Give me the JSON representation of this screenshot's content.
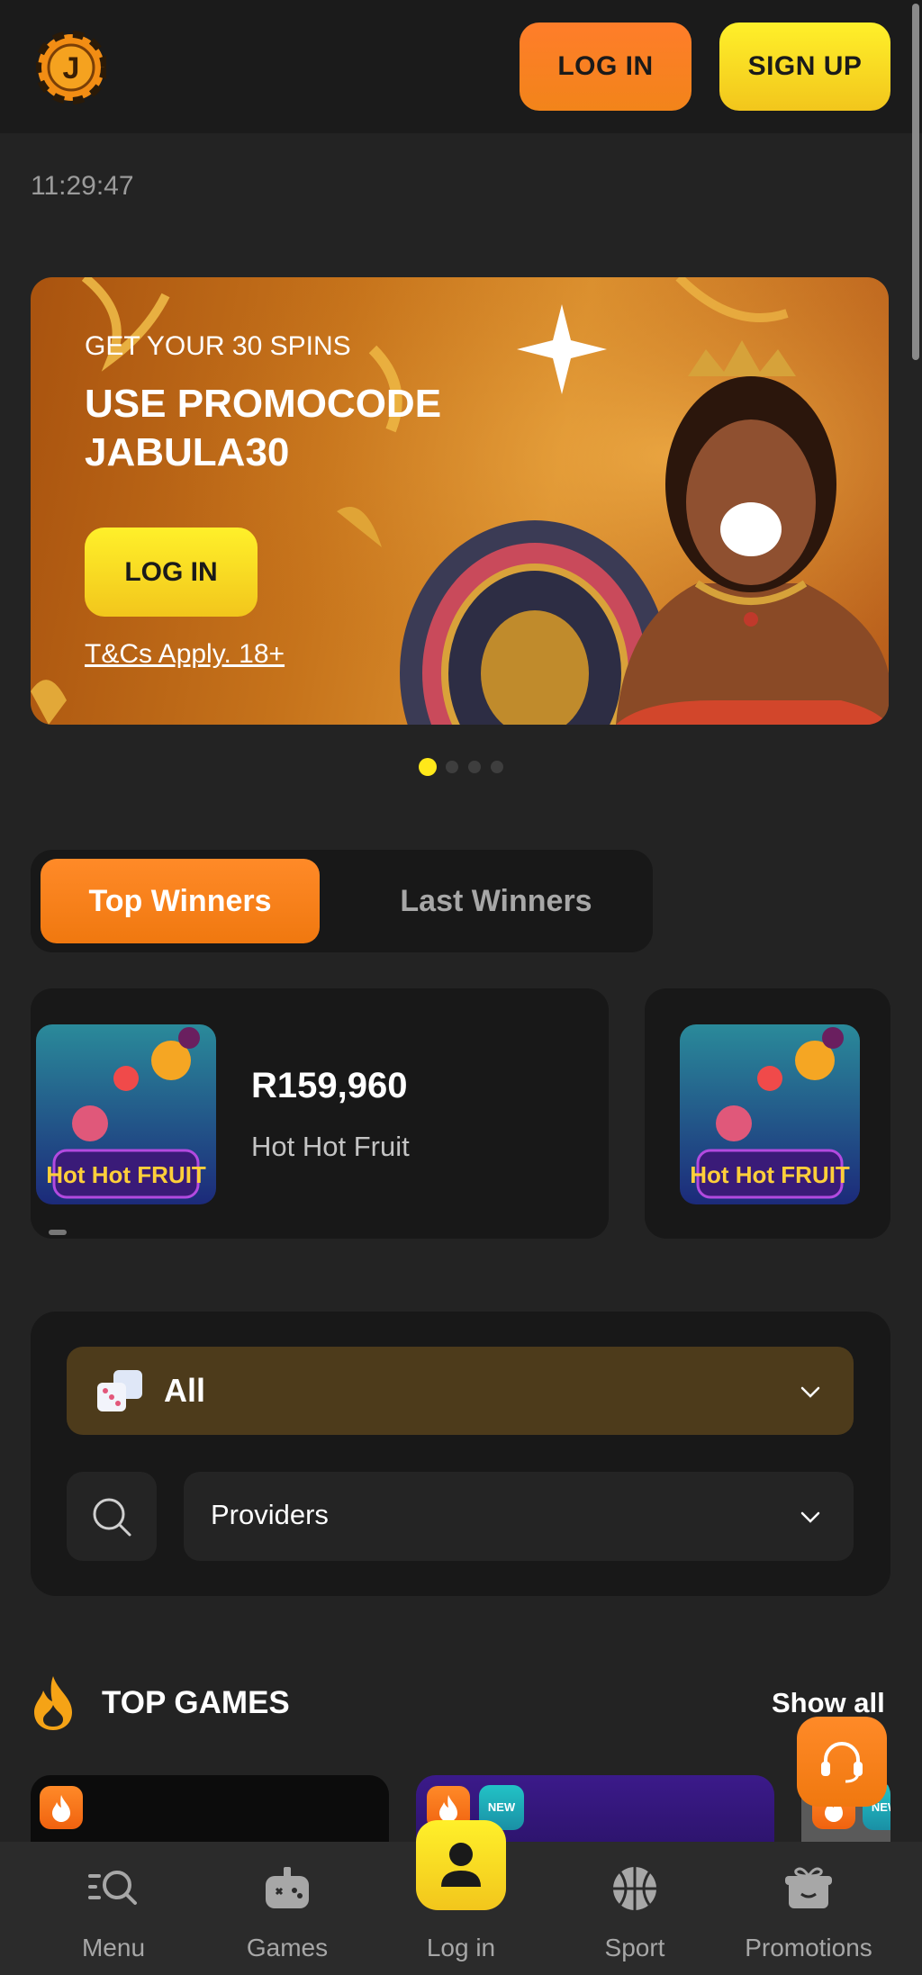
{
  "header": {
    "login_label": "LOG IN",
    "signup_label": "SIGN UP",
    "logo_letter": "J"
  },
  "clock": "11:29:47",
  "banner": {
    "subtitle": "GET YOUR 30 SPINS",
    "title": "USE PROMOCODE JABULA30",
    "login_label": "LOG IN",
    "terms": "T&Cs Apply. 18+",
    "slide_count": 4,
    "active_slide": 1
  },
  "winners": {
    "tabs": [
      "Top Winners",
      "Last Winners"
    ],
    "active_tab": "Top Winners",
    "items": [
      {
        "amount": "R159,960",
        "game": "Hot Hot Fruit",
        "thumb_text": "Hot Hot FRUIT"
      },
      {
        "thumb_text": "Hot Hot FRUIT"
      }
    ]
  },
  "filters": {
    "category": "All",
    "providers": "Providers"
  },
  "top_games": {
    "title": "TOP GAMES",
    "show_all": "Show all",
    "new_badge": "NEW"
  },
  "bottom_nav": {
    "items": [
      "Menu",
      "Games",
      "Log in",
      "Sport",
      "Promotions"
    ]
  },
  "colors": {
    "background": "#232323",
    "orange_accent": "#f2841a",
    "yellow_accent": "#f2c61c",
    "category_bg": "#4d3b1b"
  },
  "icons": {
    "menu": "menu-search-icon",
    "games": "gamepad-icon",
    "login": "user-icon",
    "sport": "basketball-icon",
    "promotions": "gift-icon",
    "support": "headset-icon",
    "search": "search-icon",
    "category": "dice-icon",
    "top_games": "flame-icon"
  }
}
